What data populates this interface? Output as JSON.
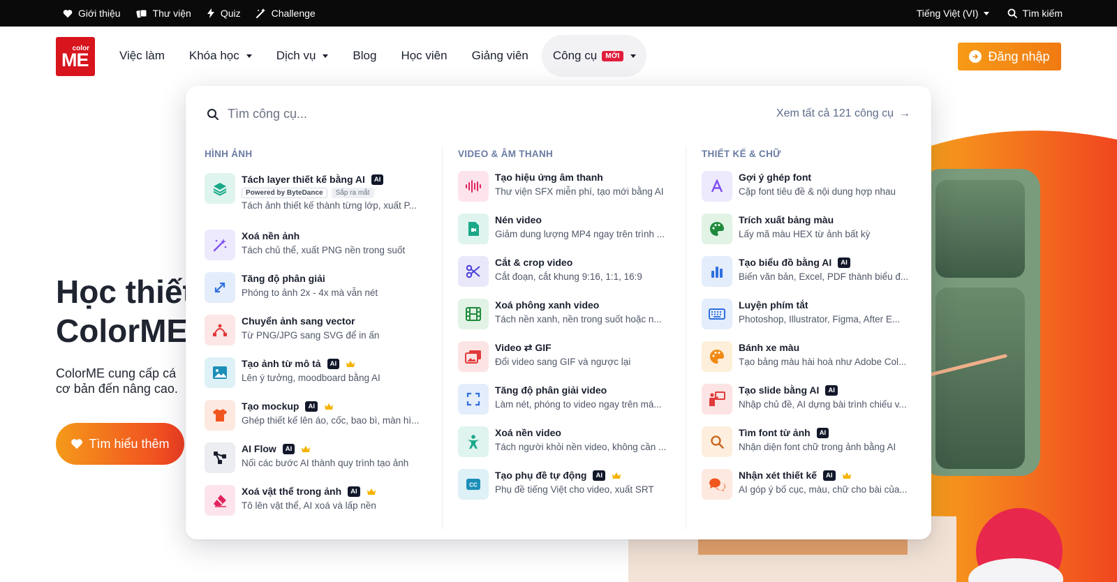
{
  "topbar": {
    "links": [
      {
        "label": "Giới thiệu",
        "icon": "heart-icon"
      },
      {
        "label": "Thư viện",
        "icon": "cards-icon"
      },
      {
        "label": "Quiz",
        "icon": "bolt-icon"
      },
      {
        "label": "Challenge",
        "icon": "magic-wand-icon"
      }
    ],
    "language": "Tiếng Việt (VI)",
    "search_label": "Tìm kiếm"
  },
  "logo": {
    "small": "color",
    "big": "ME"
  },
  "nav": {
    "jobs": "Việc làm",
    "courses": "Khóa học",
    "services": "Dịch vụ",
    "blog": "Blog",
    "students": "Học viên",
    "teachers": "Giảng viên",
    "tools": "Công cụ",
    "tools_badge": "MỚI"
  },
  "login": {
    "label": "Đăng nhập"
  },
  "hero": {
    "title_line1": "Học thiết",
    "title_line2": "ColorME",
    "desc_line1": "ColorME cung cấp cá",
    "desc_line2": "cơ bản đến nâng cao.",
    "button": "Tìm hiểu thêm"
  },
  "dropdown": {
    "search_placeholder": "Tìm công cụ...",
    "see_all": "Xem tất cả 121 công cụ",
    "col1": {
      "heading": "HÌNH ẢNH",
      "items": [
        {
          "title": "Tách layer thiết kế bằng AI",
          "ai": "AI",
          "tag1": "Powered by ByteDance",
          "tag2": "Sắp ra mắt",
          "desc": "Tách ảnh thiết kế thành từng lớp, xuất P..."
        },
        {
          "title": "Xoá nền ảnh",
          "desc": "Tách chủ thể, xuất PNG nền trong suốt"
        },
        {
          "title": "Tăng độ phân giải",
          "desc": "Phóng to ảnh 2x - 4x mà vẫn nét"
        },
        {
          "title": "Chuyển ảnh sang vector",
          "desc": "Từ PNG/JPG sang SVG để in ấn"
        },
        {
          "title": "Tạo ảnh từ mô tả",
          "ai": "AI",
          "desc": "Lên ý tưởng, moodboard bằng AI"
        },
        {
          "title": "Tạo mockup",
          "ai": "AI",
          "desc": "Ghép thiết kế lên áo, cốc, bao bì, màn hì..."
        },
        {
          "title": "AI Flow",
          "ai": "AI",
          "desc": "Nối các bước AI thành quy trình tạo ảnh"
        },
        {
          "title": "Xoá vật thể trong ảnh",
          "ai": "AI",
          "desc": "Tô lên vật thể, AI xoá và lấp nền"
        }
      ]
    },
    "col2": {
      "heading": "VIDEO & ÂM THANH",
      "items": [
        {
          "title": "Tạo hiệu ứng âm thanh",
          "desc": "Thư viện SFX miễn phí, tạo mới bằng AI"
        },
        {
          "title": "Nén video",
          "desc": "Giảm dung lượng MP4 ngay trên trình ..."
        },
        {
          "title": "Cắt & crop video",
          "desc": "Cắt đoạn, cắt khung 9:16, 1:1, 16:9"
        },
        {
          "title": "Xoá phông xanh video",
          "desc": "Tách nền xanh, nền trong suốt hoặc n..."
        },
        {
          "title": "Video ⇄ GIF",
          "desc": "Đổi video sang GIF và ngược lại"
        },
        {
          "title": "Tăng độ phân giải video",
          "desc": "Làm nét, phóng to video ngay trên má..."
        },
        {
          "title": "Xoá nền video",
          "desc": "Tách người khỏi nền video, không cần ..."
        },
        {
          "title": "Tạo phụ đề tự động",
          "ai": "AI",
          "desc": "Phụ đề tiếng Việt cho video, xuất SRT"
        }
      ]
    },
    "col3": {
      "heading": "THIẾT KẾ & CHỮ",
      "items": [
        {
          "title": "Gợi ý ghép font",
          "desc": "Cặp font tiêu đề & nội dung hợp nhau"
        },
        {
          "title": "Trích xuất bảng màu",
          "desc": "Lấy mã màu HEX từ ảnh bất kỳ"
        },
        {
          "title": "Tạo biểu đồ bằng AI",
          "ai": "AI",
          "desc": "Biến văn bản, Excel, PDF thành biểu đ..."
        },
        {
          "title": "Luyện phím tắt",
          "desc": "Photoshop, Illustrator, Figma, After E..."
        },
        {
          "title": "Bánh xe màu",
          "desc": "Tạo bảng màu hài hoà như Adobe Col..."
        },
        {
          "title": "Tạo slide bằng AI",
          "ai": "AI",
          "desc": "Nhập chủ đề, AI dựng bài trình chiếu v..."
        },
        {
          "title": "Tìm font từ ảnh",
          "ai": "AI",
          "desc": "Nhận diện font chữ trong ảnh bằng AI"
        },
        {
          "title": "Nhận xét thiết kế",
          "ai": "AI",
          "desc": "AI góp ý bố cục, màu, chữ cho bài của..."
        }
      ]
    }
  },
  "colors": {
    "brand_red": "#d8141c",
    "accent_orange": "#f0891a",
    "ai_badge": "#12182a",
    "heading_blue": "#6a7ba3"
  }
}
